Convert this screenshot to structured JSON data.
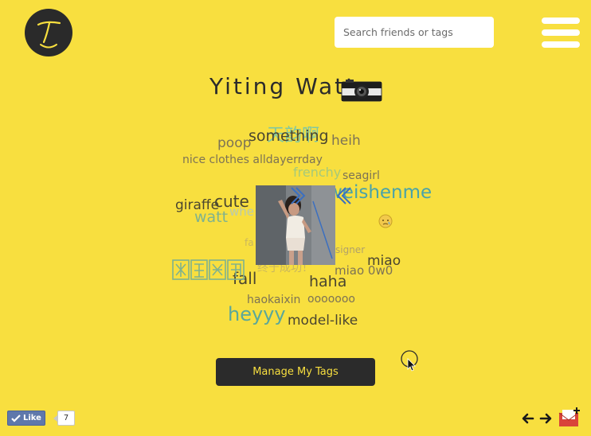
{
  "header": {
    "logo_letter": "T",
    "search_placeholder": "Search friends or tags",
    "menu_icon": "hamburger-menu-icon"
  },
  "profile": {
    "name": "Yiting Watt",
    "camera_icon": "camera-icon"
  },
  "tags": [
    {
      "text": "poop",
      "color": "#7d7355",
      "size": 17
    },
    {
      "text": "something",
      "color": "#4a4530",
      "size": 19
    },
    {
      "text": "heih",
      "color": "#7d7355",
      "size": 17
    },
    {
      "text": "nice clothes alldayerrday",
      "color": "#7d7355",
      "size": 14
    },
    {
      "text": "frenchy",
      "color": "#a5c97a",
      "size": 16
    },
    {
      "text": "seagirl",
      "color": "#7d7355",
      "size": 14
    },
    {
      "text": "giraffe",
      "color": "#4a4530",
      "size": 17
    },
    {
      "text": "cute",
      "color": "#4a4530",
      "size": 20
    },
    {
      "text": "whe",
      "color": "#b8c9b0",
      "size": 15
    },
    {
      "text": "watt",
      "color": "#7fb28e",
      "size": 19
    },
    {
      "text": "weishenme",
      "color": "#4aa3a8",
      "size": 23
    },
    {
      "text": "signer",
      "color": "#b0a06a",
      "size": 12
    },
    {
      "text": "fa",
      "color": "#c9b65e",
      "size": 12
    },
    {
      "text": "miao",
      "color": "#4a4530",
      "size": 17
    },
    {
      "text": "fall",
      "color": "#4a4530",
      "size": 20
    },
    {
      "text": "haha",
      "color": "#4a4530",
      "size": 19
    },
    {
      "text": "miao 0w0",
      "color": "#7d7355",
      "size": 15
    },
    {
      "text": "终于成功！",
      "color": "#c9b65e",
      "size": 14
    },
    {
      "text": "haokaixin",
      "color": "#7d7355",
      "size": 14
    },
    {
      "text": "ooooooo",
      "color": "#7d7355",
      "size": 14
    },
    {
      "text": "heyyy",
      "color": "#5aa79a",
      "size": 24
    },
    {
      "text": "model-like",
      "color": "#4a4530",
      "size": 17
    },
    {
      "text": "天韵啊",
      "color": "#7fc7a2",
      "size": 22
    }
  ],
  "photo": {
    "alt": "profile photo",
    "name": "profile-photo"
  },
  "manage_button_label": "Manage My Tags",
  "footer": {
    "like_label": "Like",
    "like_count": "7",
    "prev_icon": "arrow-left-icon",
    "next_icon": "arrow-right-icon",
    "mail_icon": "mail-add-icon"
  },
  "colors": {
    "background": "#f8df3f",
    "dark": "#2b2b2b",
    "accent_yellow": "#f8df3f"
  }
}
